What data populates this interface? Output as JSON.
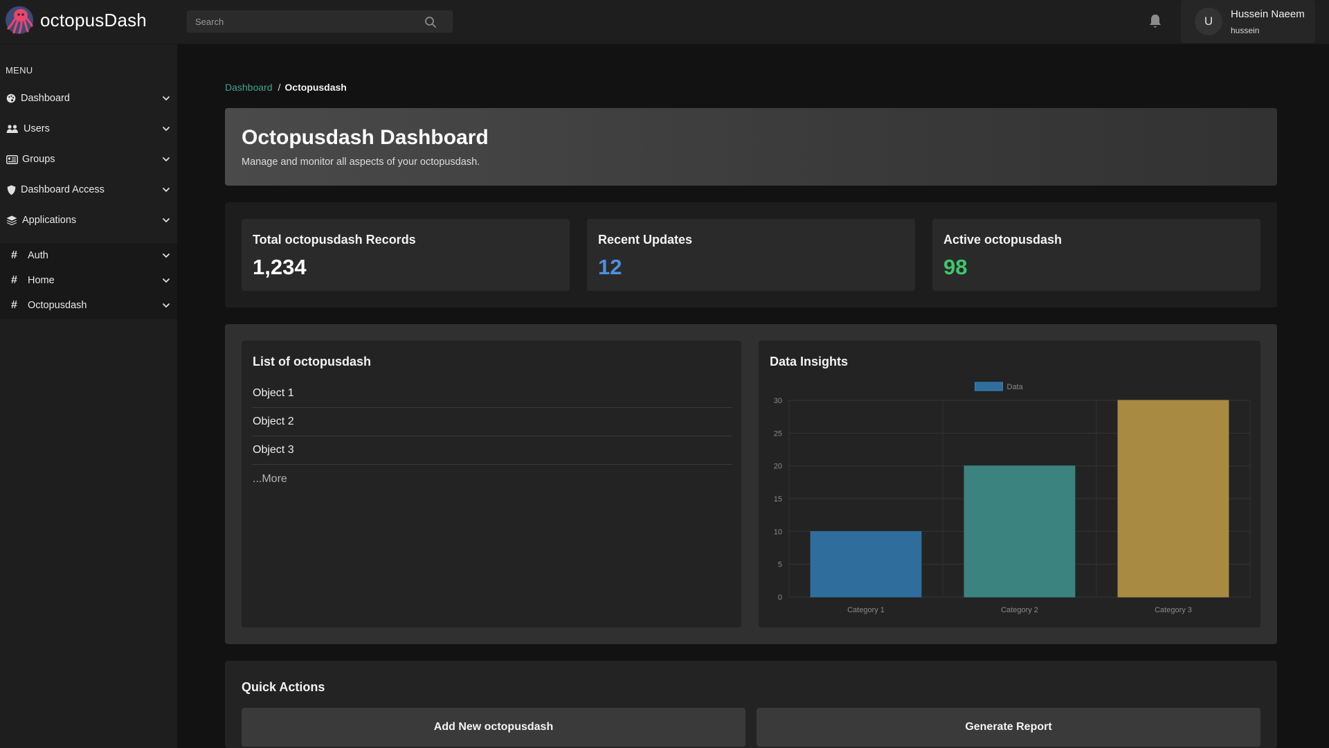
{
  "app": {
    "name": "octopusDash",
    "logo_icon": "octopus-logo-icon"
  },
  "header": {
    "search_placeholder": "Search",
    "search_icon": "search-icon",
    "notification_icon": "bell-icon",
    "user": {
      "avatar_initial": "U",
      "name": "Hussein Naeem",
      "handle": "hussein"
    }
  },
  "sidebar": {
    "menu_title": "MENU",
    "items": [
      {
        "label": "Dashboard",
        "icon": "palette-icon"
      },
      {
        "label": "Users",
        "icon": "users-icon"
      },
      {
        "label": "Groups",
        "icon": "id-card-icon"
      },
      {
        "label": "Dashboard Access",
        "icon": "shield-icon"
      },
      {
        "label": "Applications",
        "icon": "layers-icon"
      }
    ],
    "apps": [
      {
        "label": "Auth",
        "icon": "#"
      },
      {
        "label": "Home",
        "icon": "#"
      },
      {
        "label": "Octopusdash",
        "icon": "#"
      }
    ]
  },
  "breadcrumb": {
    "parent": "Dashboard",
    "separator": "/",
    "current": "Octopusdash"
  },
  "hero": {
    "title": "Octopusdash Dashboard",
    "subtitle": "Manage and monitor all aspects of your octopusdash."
  },
  "stats": [
    {
      "label": "Total octopusdash Records",
      "value": "1,234",
      "color": "#ffffff"
    },
    {
      "label": "Recent Updates",
      "value": "12",
      "color": "#4f8fe0"
    },
    {
      "label": "Active octopusdash",
      "value": "98",
      "color": "#3fc76b"
    }
  ],
  "list_card": {
    "title": "List of octopusdash",
    "items": [
      "Object 1",
      "Object 2",
      "Object 3"
    ],
    "more": "...More"
  },
  "chart_card": {
    "title": "Data Insights"
  },
  "chart_data": {
    "type": "bar",
    "categories": [
      "Category 1",
      "Category 2",
      "Category 3"
    ],
    "series": [
      {
        "name": "Data",
        "values": [
          10,
          20,
          30
        ]
      }
    ],
    "bar_colors": [
      "#2f6e9c",
      "#3a837f",
      "#a88a42"
    ],
    "legend_color": "#2f6e9c",
    "ylim": [
      0,
      30
    ],
    "yticks": [
      0,
      5,
      10,
      15,
      20,
      25,
      30
    ],
    "legend": "top",
    "grid": true
  },
  "quick_actions": {
    "title": "Quick Actions",
    "buttons": [
      "Add New octopusdash",
      "Generate Report"
    ]
  },
  "colors": {
    "accent_link": "#3aa48f",
    "background": "#121212",
    "panel": "#1e1e1e"
  }
}
